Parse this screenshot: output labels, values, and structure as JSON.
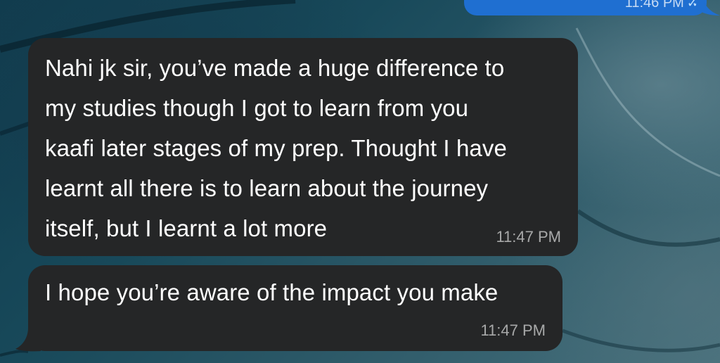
{
  "sent_message": {
    "time": "11:46 PM",
    "status_icon": "double-check-icon"
  },
  "messages": [
    {
      "lines": [
        "Nahi jk sir, you’ve made a huge difference to",
        "my studies though I got to learn from you",
        "kaafi later stages of my prep. Thought I have",
        "learnt all there is to learn about the journey",
        "itself, but I learnt a lot more"
      ],
      "time": "11:47 PM"
    },
    {
      "text": "I hope you’re aware of the impact you make",
      "time": "11:47 PM"
    }
  ],
  "colors": {
    "received_bubble": "#252627",
    "sent_bubble": "#1f6fd1",
    "wallpaper_base": "#18495a"
  }
}
